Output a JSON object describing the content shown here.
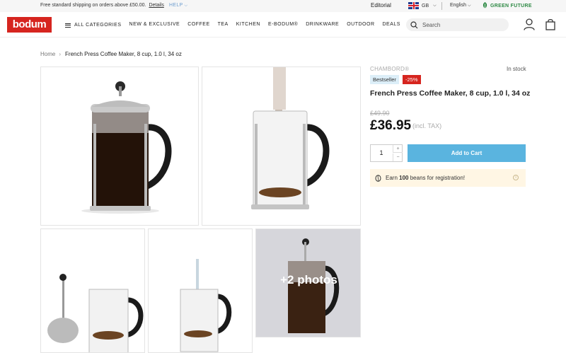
{
  "topbar": {
    "shipping": "Free standard shipping on orders above £50.00.",
    "details": "Details",
    "help": "HELP",
    "editorial": "Editorial",
    "region": "GB",
    "language": "English",
    "green_future": "GREEN FUTURE"
  },
  "header": {
    "logo": "bodum",
    "nav": [
      "ALL CATEGORIES",
      "NEW & EXCLUSIVE",
      "COFFEE",
      "TEA",
      "KITCHEN",
      "E-BODUM®",
      "DRINKWARE",
      "OUTDOOR",
      "DEALS"
    ],
    "search_placeholder": "Search"
  },
  "breadcrumb": {
    "home": "Home",
    "current": "French Press Coffee Maker, 8 cup, 1.0 l, 34 oz"
  },
  "gallery": {
    "more_photos": "+2 photos"
  },
  "product": {
    "brand": "CHAMBORD®",
    "stock": "In stock",
    "badge_bestseller": "Bestseller",
    "badge_discount": "-25%",
    "title": "French Press Coffee Maker, 8 cup, 1.0 l, 34 oz",
    "old_price": "£49.90",
    "price": "£36.95",
    "tax_note": "(incl. TAX)",
    "quantity": "1",
    "add_to_cart": "Add to Cart",
    "beans_prefix": "Earn",
    "beans_count": "100",
    "beans_suffix": "beans for registration!"
  },
  "colors": {
    "brand_red": "#d6251f",
    "cart_blue": "#5ab4df",
    "green": "#2f8a45"
  }
}
